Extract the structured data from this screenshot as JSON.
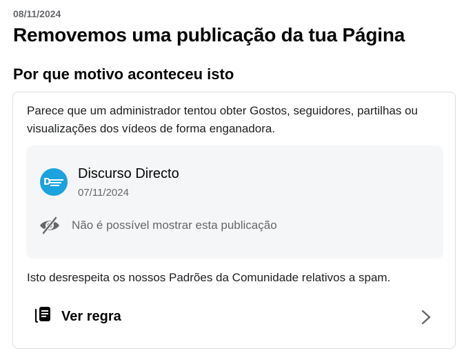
{
  "header": {
    "date": "08/11/2024",
    "title": "Removemos uma publicação da tua Página"
  },
  "section": {
    "title": "Por que motivo aconteceu isto"
  },
  "card": {
    "reason": "Parece que um administrador tentou obter Gostos, seguidores, partilhas ou visualizações dos vídeos de forma enganadora.",
    "post": {
      "page_name": "Discurso Directo",
      "date": "07/11/2024",
      "avatar_logo_text": "Discurso Directo",
      "avatar_color": "#1aa3dc",
      "hidden_icon": "eye-slash-icon",
      "hidden_text": "Não é possível mostrar esta publicação"
    },
    "violation": "Isto desrespeita os nossos Padrões da Comunidade relativos a spam.",
    "rule_link": {
      "icon": "book-icon",
      "label": "Ver regra",
      "chevron_icon": "chevron-right-icon"
    }
  }
}
